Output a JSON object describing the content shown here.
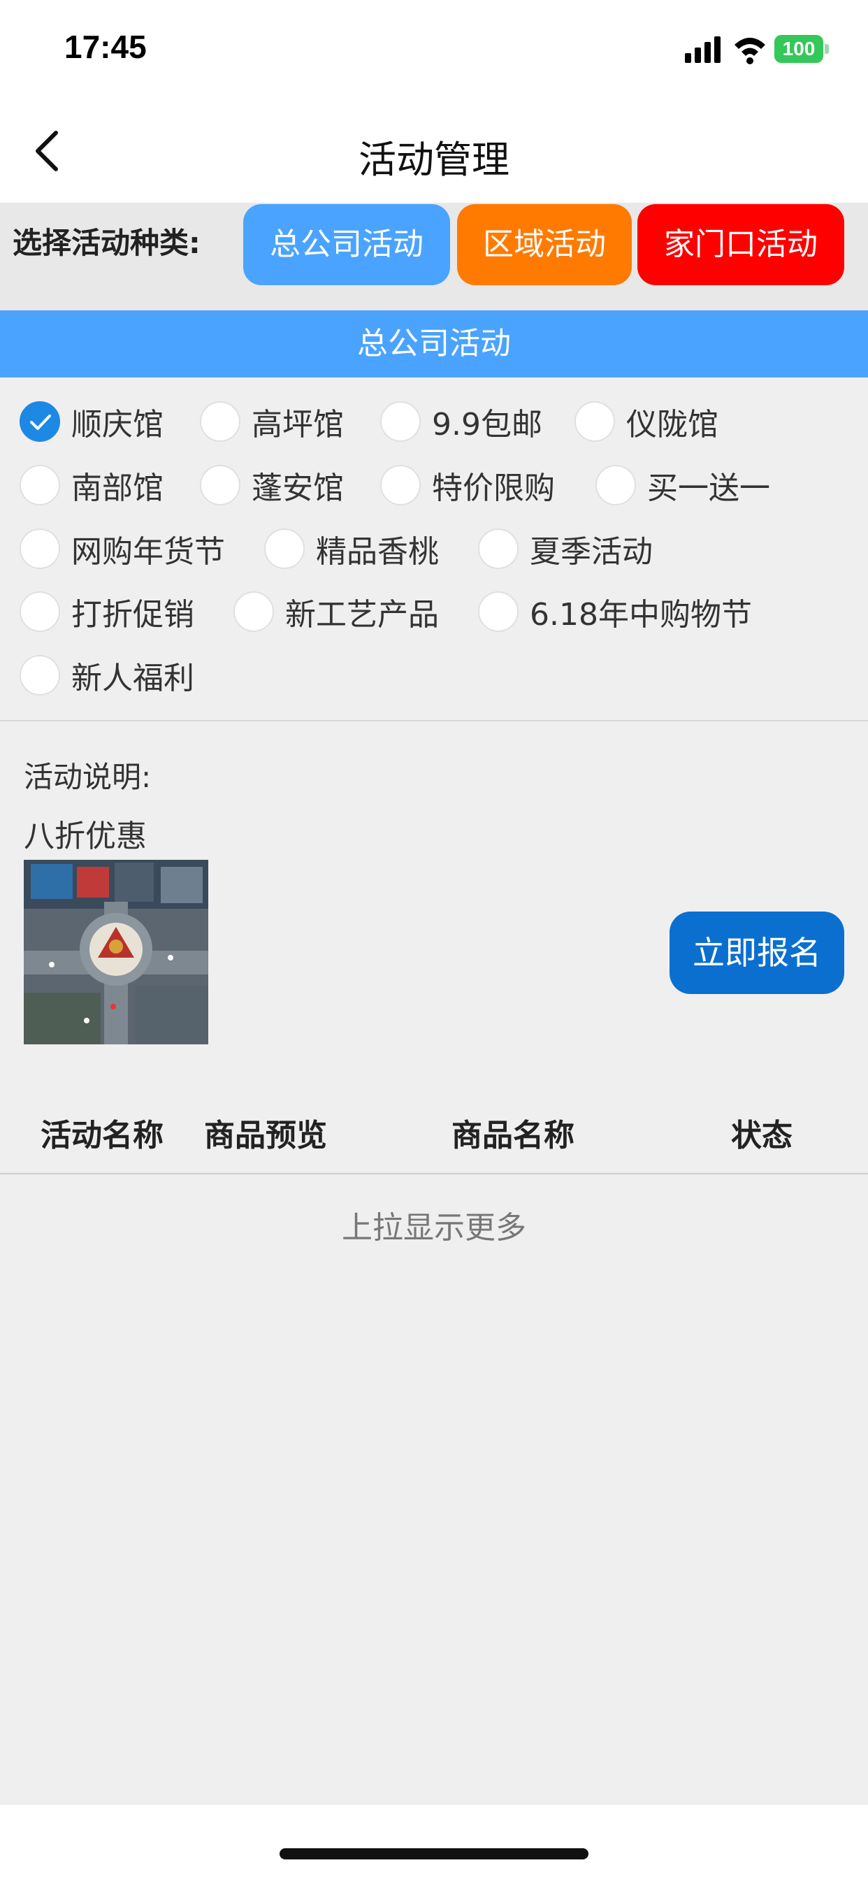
{
  "status": {
    "time": "17:45",
    "battery": "100"
  },
  "nav": {
    "title": "活动管理"
  },
  "category": {
    "label": "选择活动种类:",
    "buttons": [
      "总公司活动",
      "区域活动",
      "家门口活动"
    ],
    "colors": {
      "head_office": "#4aa3ff",
      "regional": "#ff7a00",
      "doorstep": "#ff0000"
    }
  },
  "section": {
    "title": "总公司活动"
  },
  "options": [
    {
      "label": "顺庆馆",
      "checked": true
    },
    {
      "label": "高坪馆",
      "checked": false
    },
    {
      "label": "9.9包邮",
      "checked": false
    },
    {
      "label": "仪陇馆",
      "checked": false
    },
    {
      "label": "南部馆",
      "checked": false
    },
    {
      "label": "蓬安馆",
      "checked": false
    },
    {
      "label": "特价限购",
      "checked": false
    },
    {
      "label": "买一送一",
      "checked": false
    },
    {
      "label": "网购年货节",
      "checked": false
    },
    {
      "label": "精品香桃",
      "checked": false
    },
    {
      "label": "夏季活动",
      "checked": false
    },
    {
      "label": "打折促销",
      "checked": false
    },
    {
      "label": "新工艺产品",
      "checked": false
    },
    {
      "label": "6.18年中购物节",
      "checked": false
    },
    {
      "label": "新人福利",
      "checked": false
    }
  ],
  "description": {
    "title": "活动说明:",
    "text": "八折优惠"
  },
  "signup_button": "立即报名",
  "table": {
    "headers": [
      "活动名称",
      "商品预览",
      "商品名称",
      "状态"
    ]
  },
  "load_more": "上拉显示更多",
  "accent_color": "#1e88e5"
}
